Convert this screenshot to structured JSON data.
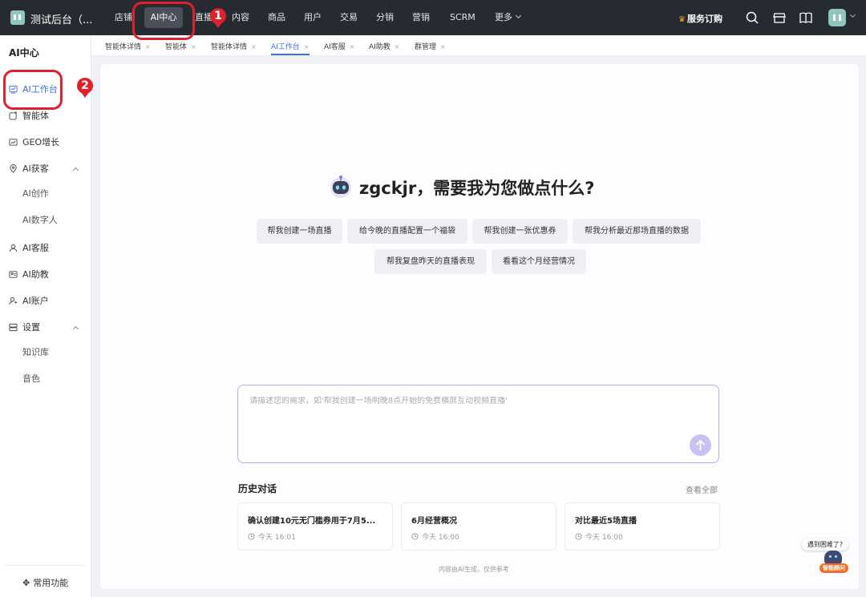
{
  "topbar": {
    "app_title": "测试后台（...",
    "nav": [
      "店铺",
      "AI中心",
      "直播",
      "内容",
      "商品",
      "用户",
      "交易",
      "分销",
      "营销",
      "SCRM",
      "更多"
    ],
    "active_nav": "AI中心",
    "subscribe_label": "服务订购",
    "icons": [
      "search-icon",
      "store-icon",
      "book-icon",
      "avatar"
    ]
  },
  "sidebar": {
    "heading": "AI中心",
    "items": [
      {
        "label": "AI工作台",
        "icon": "dashboard-icon",
        "active": true
      },
      {
        "label": "智能体",
        "icon": "agent-icon"
      },
      {
        "label": "GEO增长",
        "icon": "growth-icon"
      },
      {
        "label": "AI获客",
        "icon": "location-icon",
        "expanded": true,
        "children": [
          "AI创作",
          "AI数字人"
        ]
      },
      {
        "label": "AI客服",
        "icon": "person-icon"
      },
      {
        "label": "AI助教",
        "icon": "assistant-icon"
      },
      {
        "label": "AI账户",
        "icon": "account-icon"
      },
      {
        "label": "设置",
        "icon": "settings-icon",
        "expanded": true,
        "children": [
          "知识库",
          "音色"
        ]
      }
    ],
    "footer": "常用功能"
  },
  "tabs": [
    {
      "label": "智能体详情",
      "close": "×"
    },
    {
      "label": "智能体",
      "close": "×"
    },
    {
      "label": "智能体详情",
      "close": "×"
    },
    {
      "label": "AI工作台",
      "close": "×",
      "active": true
    },
    {
      "label": "AI客服",
      "close": "×"
    },
    {
      "label": "AI助教",
      "close": "×"
    },
    {
      "label": "群管理",
      "close": "×"
    }
  ],
  "main": {
    "greeting": "zgckjr，需要我为您做点什么?",
    "suggestions": [
      "帮我创建一场直播",
      "给今晚的直播配置一个福袋",
      "帮我创建一张优惠券",
      "帮我分析最近那场直播的数据",
      "帮我复盘昨天的直播表现",
      "看看这个月经营情况"
    ],
    "prompt_placeholder": "请描述您的需求，如'帮我创建一场明晚8点开始的免费横屏互动视频直播'",
    "history_title": "历史对话",
    "view_all": "查看全部",
    "history": [
      {
        "title": "确认创建10元无门槛券用于7月5...",
        "time": "今天 16:01"
      },
      {
        "title": "6月经营概况",
        "time": "今天 16:00"
      },
      {
        "title": "对比最近5场直播",
        "time": "今天 16:00"
      }
    ],
    "footnote": "内容由AI生成，仅供参考"
  },
  "help": {
    "bubble": "遇到困难了?",
    "label": "智能顾问"
  },
  "annotations": {
    "badge1": "1",
    "badge2": "2"
  },
  "colors": {
    "topbar": "#262a31",
    "accent": "#3a6fe0",
    "annotation": "#e0202a",
    "prompt_border": "#b7aaf0"
  }
}
